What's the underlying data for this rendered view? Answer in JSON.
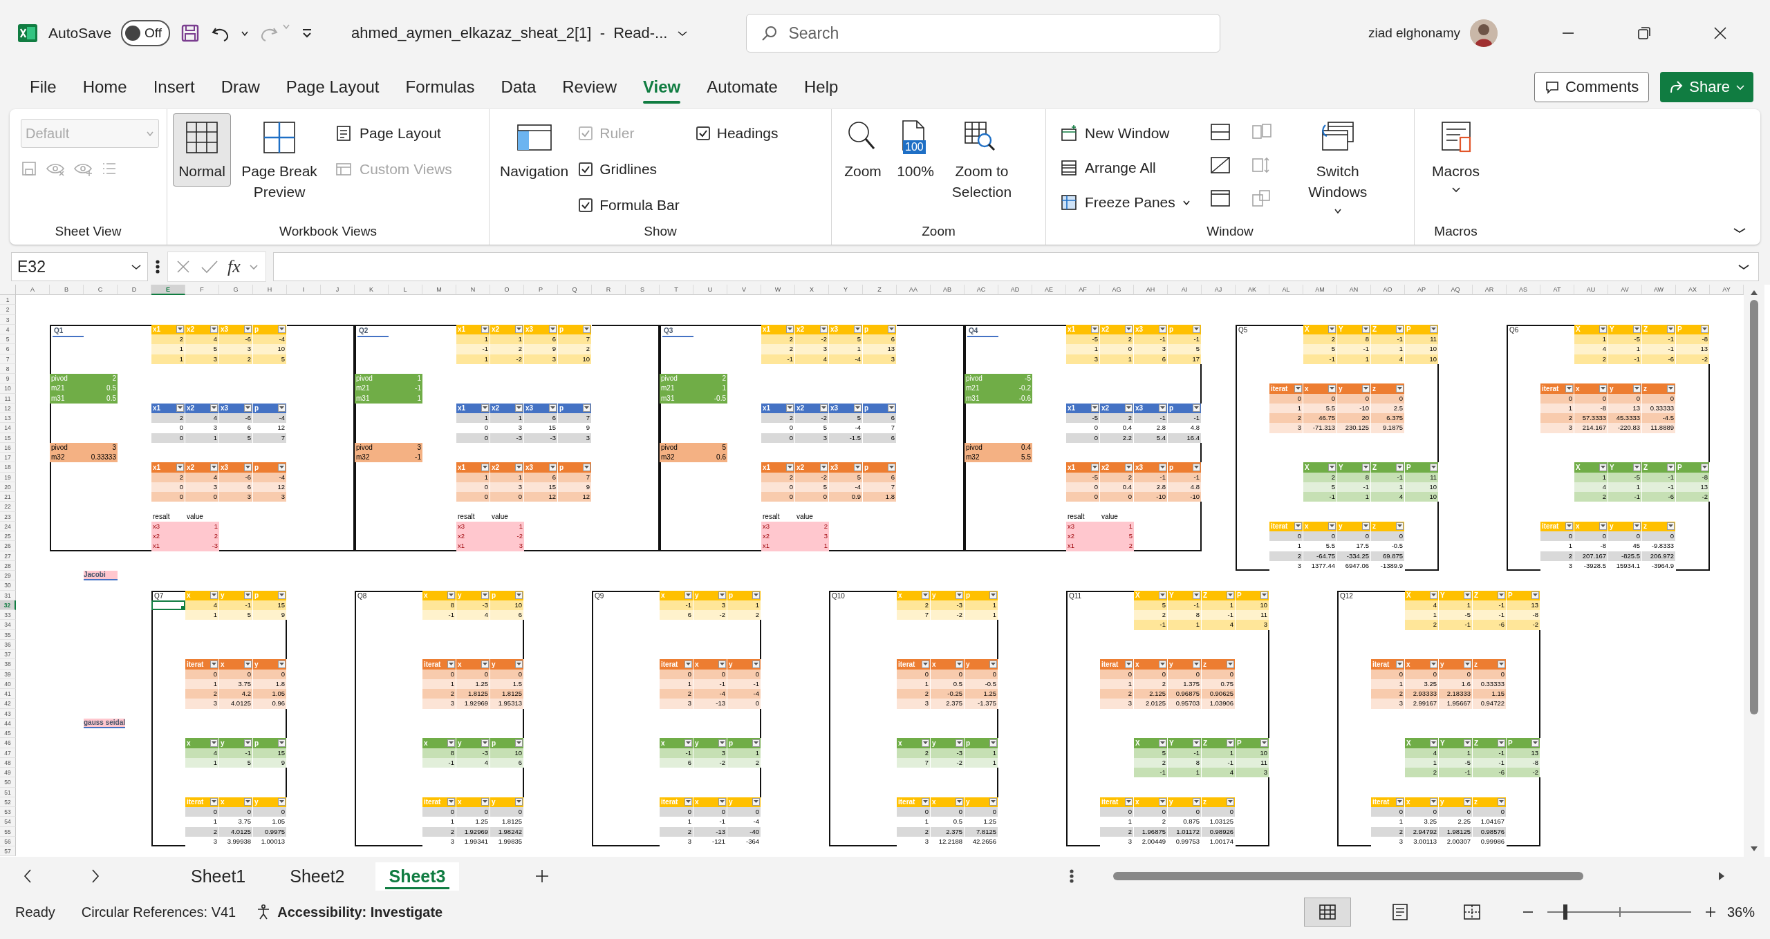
{
  "title_bar": {
    "autosave_label": "AutoSave",
    "autosave": {
      "on": false,
      "label": "Off"
    },
    "filename": "ahmed_aymen_elkazaz_sheat_2[1]  -  Read-...",
    "search_placeholder": "Search",
    "user": "ziad elghonamy"
  },
  "menu": {
    "tabs": [
      {
        "label": "File",
        "selected": false
      },
      {
        "label": "Home",
        "selected": false
      },
      {
        "label": "Insert",
        "selected": false
      },
      {
        "label": "Draw",
        "selected": false
      },
      {
        "label": "Page Layout",
        "selected": false
      },
      {
        "label": "Formulas",
        "selected": false
      },
      {
        "label": "Data",
        "selected": false
      },
      {
        "label": "Review",
        "selected": false
      },
      {
        "label": "View",
        "selected": true
      },
      {
        "label": "Automate",
        "selected": false
      },
      {
        "label": "Help",
        "selected": false
      }
    ],
    "comments": "Comments",
    "share": "Share"
  },
  "ribbon": {
    "sheet_view": {
      "label": "Sheet View",
      "dropdown": {
        "value": "Default",
        "disabled": true
      }
    },
    "workbook_views": {
      "label": "Workbook Views",
      "buttons": [
        {
          "label": "Normal",
          "selected": true
        },
        {
          "label": "Page Break Preview",
          "selected": false
        }
      ],
      "small_buttons": [
        {
          "label": "Page Layout",
          "disabled": false
        },
        {
          "label": "Custom Views",
          "disabled": true
        }
      ]
    },
    "show": {
      "label": "Show",
      "navigation": "Navigation",
      "checkboxes": [
        {
          "label": "Ruler",
          "checked": true,
          "disabled": true
        },
        {
          "label": "Gridlines",
          "checked": true,
          "disabled": false
        },
        {
          "label": "Formula Bar",
          "checked": true,
          "disabled": false
        },
        {
          "label": "Headings",
          "checked": true,
          "disabled": false
        }
      ]
    },
    "zoom": {
      "label": "Zoom",
      "buttons": [
        {
          "label": "Zoom"
        },
        {
          "label": "100%",
          "badge": "100"
        },
        {
          "label": "Zoom to Selection"
        }
      ]
    },
    "window": {
      "label": "Window",
      "buttons": [
        {
          "label": "New Window"
        },
        {
          "label": "Arrange All"
        },
        {
          "label": "Freeze Panes"
        }
      ],
      "switch": "Switch Windows"
    },
    "macros": {
      "label": "Macros",
      "button": "Macros"
    }
  },
  "formula_bar": {
    "name_box": "E32",
    "function_label": "fx"
  },
  "sheet": {
    "columns": [
      {
        "label": "A",
        "selected": false
      },
      {
        "label": "B",
        "selected": false
      },
      {
        "label": "C",
        "selected": false
      },
      {
        "label": "D",
        "selected": false
      },
      {
        "label": "E",
        "selected": true
      },
      {
        "label": "F",
        "selected": false
      },
      {
        "label": "G",
        "selected": false
      },
      {
        "label": "H",
        "selected": false
      },
      {
        "label": "I",
        "selected": false
      },
      {
        "label": "J",
        "selected": false
      },
      {
        "label": "K",
        "selected": false
      },
      {
        "label": "L",
        "selected": false
      },
      {
        "label": "M",
        "selected": false
      },
      {
        "label": "N",
        "selected": false
      },
      {
        "label": "O",
        "selected": false
      },
      {
        "label": "P",
        "selected": false
      },
      {
        "label": "Q",
        "selected": false
      },
      {
        "label": "R",
        "selected": false
      },
      {
        "label": "S",
        "selected": false
      },
      {
        "label": "T",
        "selected": false
      },
      {
        "label": "U",
        "selected": false
      },
      {
        "label": "V",
        "selected": false
      },
      {
        "label": "W",
        "selected": false
      },
      {
        "label": "X",
        "selected": false
      },
      {
        "label": "Y",
        "selected": false
      },
      {
        "label": "Z",
        "selected": false
      },
      {
        "label": "AA",
        "selected": false
      },
      {
        "label": "AB",
        "selected": false
      },
      {
        "label": "AC",
        "selected": false
      },
      {
        "label": "AD",
        "selected": false
      },
      {
        "label": "AE",
        "selected": false
      },
      {
        "label": "AF",
        "selected": false
      },
      {
        "label": "AG",
        "selected": false
      },
      {
        "label": "AH",
        "selected": false
      },
      {
        "label": "AI",
        "selected": false
      },
      {
        "label": "AJ",
        "selected": false
      },
      {
        "label": "AK",
        "selected": false
      },
      {
        "label": "AL",
        "selected": false
      },
      {
        "label": "AM",
        "selected": false
      },
      {
        "label": "AN",
        "selected": false
      },
      {
        "label": "AO",
        "selected": false
      },
      {
        "label": "AP",
        "selected": false
      },
      {
        "label": "AQ",
        "selected": false
      },
      {
        "label": "AR",
        "selected": false
      },
      {
        "label": "AS",
        "selected": false
      },
      {
        "label": "AT",
        "selected": false
      },
      {
        "label": "AU",
        "selected": false
      },
      {
        "label": "AV",
        "selected": false
      },
      {
        "label": "AW",
        "selected": false
      },
      {
        "label": "AX",
        "selected": false
      },
      {
        "label": "AY",
        "selected": false
      }
    ],
    "rows": [
      {
        "label": "1",
        "selected": false
      },
      {
        "label": "2",
        "selected": false
      },
      {
        "label": "3",
        "selected": false
      },
      {
        "label": "4",
        "selected": false
      },
      {
        "label": "5",
        "selected": false
      },
      {
        "label": "6",
        "selected": false
      },
      {
        "label": "7",
        "selected": false
      },
      {
        "label": "8",
        "selected": false
      },
      {
        "label": "9",
        "selected": false
      },
      {
        "label": "10",
        "selected": false
      },
      {
        "label": "11",
        "selected": false
      },
      {
        "label": "12",
        "selected": false
      },
      {
        "label": "13",
        "selected": false
      },
      {
        "label": "14",
        "selected": false
      },
      {
        "label": "15",
        "selected": false
      },
      {
        "label": "16",
        "selected": false
      },
      {
        "label": "17",
        "selected": false
      },
      {
        "label": "18",
        "selected": false
      },
      {
        "label": "19",
        "selected": false
      },
      {
        "label": "20",
        "selected": false
      },
      {
        "label": "21",
        "selected": false
      },
      {
        "label": "22",
        "selected": false
      },
      {
        "label": "23",
        "selected": false
      },
      {
        "label": "24",
        "selected": false
      },
      {
        "label": "25",
        "selected": false
      },
      {
        "label": "26",
        "selected": false
      },
      {
        "label": "27",
        "selected": false
      },
      {
        "label": "28",
        "selected": false
      },
      {
        "label": "29",
        "selected": false
      },
      {
        "label": "30",
        "selected": false
      },
      {
        "label": "31",
        "selected": false
      },
      {
        "label": "32",
        "selected": true
      },
      {
        "label": "33",
        "selected": false
      },
      {
        "label": "34",
        "selected": false
      },
      {
        "label": "35",
        "selected": false
      },
      {
        "label": "36",
        "selected": false
      },
      {
        "label": "37",
        "selected": false
      },
      {
        "label": "38",
        "selected": false
      },
      {
        "label": "39",
        "selected": false
      },
      {
        "label": "40",
        "selected": false
      },
      {
        "label": "41",
        "selected": false
      },
      {
        "label": "42",
        "selected": false
      },
      {
        "label": "43",
        "selected": false
      },
      {
        "label": "44",
        "selected": false
      },
      {
        "label": "45",
        "selected": false
      },
      {
        "label": "46",
        "selected": false
      },
      {
        "label": "47",
        "selected": false
      },
      {
        "label": "48",
        "selected": false
      },
      {
        "label": "49",
        "selected": false
      },
      {
        "label": "50",
        "selected": false
      },
      {
        "label": "51",
        "selected": false
      },
      {
        "label": "52",
        "selected": false
      },
      {
        "label": "53",
        "selected": false
      },
      {
        "label": "54",
        "selected": false
      },
      {
        "label": "55",
        "selected": false
      },
      {
        "label": "56",
        "selected": false
      },
      {
        "label": "57",
        "selected": false
      }
    ],
    "notes": [
      {
        "text": "Jacobi"
      },
      {
        "text": "gauss seidal"
      }
    ],
    "sections": [
      {
        "label": "Q1",
        "kind": "elimination",
        "tables": [
          {
            "columns": [
              "x1",
              "x2",
              "x3",
              "p"
            ],
            "rows": [
              [
                "2",
                "4",
                "-6",
                "-4"
              ],
              [
                "1",
                "5",
                "3",
                "10"
              ],
              [
                "1",
                "3",
                "2",
                "5"
              ]
            ]
          },
          {
            "columns": [
              "x1",
              "x2",
              "x3",
              "p"
            ],
            "rows": [
              [
                "2",
                "4",
                "-6",
                "-4"
              ],
              [
                "0",
                "3",
                "6",
                "12"
              ],
              [
                "0",
                "1",
                "5",
                "7"
              ]
            ]
          },
          {
            "columns": [
              "x1",
              "x2",
              "x3",
              "p"
            ],
            "rows": [
              [
                "2",
                "4",
                "-6",
                "-4"
              ],
              [
                "0",
                "3",
                "6",
                "12"
              ],
              [
                "0",
                "0",
                "3",
                "3"
              ]
            ]
          }
        ],
        "pivots": [
          {
            "rows": [
              [
                "pivod",
                "2"
              ],
              [
                "m21",
                "0.5"
              ],
              [
                "m31",
                "0.5"
              ]
            ]
          },
          {
            "rows": [
              [
                "pivod",
                "3"
              ],
              [
                "m32",
                "0.33333"
              ]
            ]
          }
        ],
        "result": {
          "columns": [
            "resalt",
            "value"
          ],
          "rows": [
            [
              "x3",
              "1"
            ],
            [
              "x2",
              "2"
            ],
            [
              "x1",
              "-3"
            ]
          ]
        }
      },
      {
        "label": "Q2",
        "kind": "elimination",
        "tables": [
          {
            "columns": [
              "x1",
              "x2",
              "x3",
              "p"
            ],
            "rows": [
              [
                "1",
                "1",
                "6",
                "7"
              ],
              [
                "-1",
                "2",
                "9",
                "2"
              ],
              [
                "1",
                "-2",
                "3",
                "10"
              ]
            ]
          },
          {
            "columns": [
              "x1",
              "x2",
              "x3",
              "p"
            ],
            "rows": [
              [
                "1",
                "1",
                "6",
                "7"
              ],
              [
                "0",
                "3",
                "15",
                "9"
              ],
              [
                "0",
                "-3",
                "-3",
                "3"
              ]
            ]
          },
          {
            "columns": [
              "x1",
              "x2",
              "x3",
              "p"
            ],
            "rows": [
              [
                "1",
                "1",
                "6",
                "7"
              ],
              [
                "0",
                "3",
                "15",
                "9"
              ],
              [
                "0",
                "0",
                "12",
                "12"
              ]
            ]
          }
        ],
        "pivots": [
          {
            "rows": [
              [
                "pivod",
                "1"
              ],
              [
                "m21",
                "-1"
              ],
              [
                "m31",
                "1"
              ]
            ]
          },
          {
            "rows": [
              [
                "pivod",
                "3"
              ],
              [
                "m32",
                "-1"
              ]
            ]
          }
        ],
        "result": {
          "columns": [
            "resalt",
            "value"
          ],
          "rows": [
            [
              "x3",
              "1"
            ],
            [
              "x2",
              "-2"
            ],
            [
              "x1",
              "3"
            ]
          ]
        }
      },
      {
        "label": "Q3",
        "kind": "elimination",
        "tables": [
          {
            "columns": [
              "x1",
              "x2",
              "x3",
              "p"
            ],
            "rows": [
              [
                "2",
                "-2",
                "5",
                "6"
              ],
              [
                "2",
                "3",
                "1",
                "13"
              ],
              [
                "-1",
                "4",
                "-4",
                "3"
              ]
            ]
          },
          {
            "columns": [
              "x1",
              "x2",
              "x3",
              "p"
            ],
            "rows": [
              [
                "2",
                "-2",
                "5",
                "6"
              ],
              [
                "0",
                "5",
                "-4",
                "7"
              ],
              [
                "0",
                "3",
                "-1.5",
                "6"
              ]
            ]
          },
          {
            "columns": [
              "x1",
              "x2",
              "x3",
              "p"
            ],
            "rows": [
              [
                "2",
                "-2",
                "5",
                "6"
              ],
              [
                "0",
                "5",
                "-4",
                "7"
              ],
              [
                "0",
                "0",
                "0.9",
                "1.8"
              ]
            ]
          }
        ],
        "pivots": [
          {
            "rows": [
              [
                "pivod",
                "2"
              ],
              [
                "m21",
                "1"
              ],
              [
                "m31",
                "-0.5"
              ]
            ]
          },
          {
            "rows": [
              [
                "pivod",
                "5"
              ],
              [
                "m32",
                "0.6"
              ]
            ]
          }
        ],
        "result": {
          "columns": [
            "resalt",
            "value"
          ],
          "rows": [
            [
              "x3",
              "2"
            ],
            [
              "x2",
              "3"
            ],
            [
              "x1",
              "1"
            ]
          ]
        }
      },
      {
        "label": "Q4",
        "kind": "elimination",
        "tables": [
          {
            "columns": [
              "x1",
              "x2",
              "x3",
              "p"
            ],
            "rows": [
              [
                "-5",
                "2",
                "-1",
                "-1"
              ],
              [
                "1",
                "0",
                "3",
                "5"
              ],
              [
                "3",
                "1",
                "6",
                "17"
              ]
            ]
          },
          {
            "columns": [
              "x1",
              "x2",
              "x3",
              "p"
            ],
            "rows": [
              [
                "-5",
                "2",
                "-1",
                "-1"
              ],
              [
                "0",
                "0.4",
                "2.8",
                "4.8"
              ],
              [
                "0",
                "2.2",
                "5.4",
                "16.4"
              ]
            ]
          },
          {
            "columns": [
              "x1",
              "x2",
              "x3",
              "p"
            ],
            "rows": [
              [
                "-5",
                "2",
                "-1",
                "-1"
              ],
              [
                "0",
                "0.4",
                "2.8",
                "4.8"
              ],
              [
                "0",
                "0",
                "-10",
                "-10"
              ]
            ]
          }
        ],
        "pivots": [
          {
            "rows": [
              [
                "pivod",
                "-5"
              ],
              [
                "m21",
                "-0.2"
              ],
              [
                "m31",
                "-0.6"
              ]
            ]
          },
          {
            "rows": [
              [
                "pivod",
                "0.4"
              ],
              [
                "m32",
                "5.5"
              ]
            ]
          }
        ],
        "result": {
          "columns": [
            "resalt",
            "value"
          ],
          "rows": [
            [
              "x3",
              "1"
            ],
            [
              "x2",
              "5"
            ],
            [
              "x1",
              "2"
            ]
          ]
        }
      },
      {
        "label": "Q5",
        "kind": "iteration",
        "tables": [
          {
            "columns": [
              "X",
              "Y",
              "Z",
              "P"
            ],
            "rows": [
              [
                "2",
                "8",
                "-1",
                "11"
              ],
              [
                "5",
                "-1",
                "1",
                "10"
              ],
              [
                "-1",
                "1",
                "4",
                "10"
              ]
            ]
          },
          {
            "columns": [
              "iterat",
              "x",
              "y",
              "z"
            ],
            "rows": [
              [
                "0",
                "0",
                "0",
                "0"
              ],
              [
                "1",
                "5.5",
                "-10",
                "2.5"
              ],
              [
                "2",
                "46.75",
                "20",
                "6.375"
              ],
              [
                "3",
                "-71.313",
                "230.125",
                "9.1875"
              ]
            ]
          },
          {
            "columns": [
              "X",
              "Y",
              "Z",
              "P"
            ],
            "rows": [
              [
                "2",
                "8",
                "-1",
                "11"
              ],
              [
                "5",
                "-1",
                "1",
                "10"
              ],
              [
                "-1",
                "1",
                "4",
                "10"
              ]
            ]
          },
          {
            "columns": [
              "iterat",
              "x",
              "y",
              "z"
            ],
            "rows": [
              [
                "0",
                "0",
                "0",
                "0"
              ],
              [
                "1",
                "5.5",
                "17.5",
                "-0.5"
              ],
              [
                "2",
                "-64.75",
                "-334.25",
                "69.875"
              ],
              [
                "3",
                "1377.44",
                "6947.06",
                "-1389.9"
              ]
            ]
          }
        ]
      },
      {
        "label": "Q6",
        "kind": "iteration",
        "tables": [
          {
            "columns": [
              "X",
              "Y",
              "Z",
              "P"
            ],
            "rows": [
              [
                "1",
                "-5",
                "-1",
                "-8"
              ],
              [
                "4",
                "1",
                "-1",
                "13"
              ],
              [
                "2",
                "-1",
                "-6",
                "-2"
              ]
            ]
          },
          {
            "columns": [
              "iterat",
              "x",
              "y",
              "z"
            ],
            "rows": [
              [
                "0",
                "0",
                "0",
                "0"
              ],
              [
                "1",
                "-8",
                "13",
                "0.33333"
              ],
              [
                "2",
                "57.3333",
                "45.3333",
                "-4.5"
              ],
              [
                "3",
                "214.167",
                "-220.83",
                "11.8889"
              ]
            ]
          },
          {
            "columns": [
              "X",
              "Y",
              "Z",
              "P"
            ],
            "rows": [
              [
                "1",
                "-5",
                "-1",
                "-8"
              ],
              [
                "4",
                "1",
                "-1",
                "13"
              ],
              [
                "2",
                "-1",
                "-6",
                "-2"
              ]
            ]
          },
          {
            "columns": [
              "iterat",
              "x",
              "y",
              "z"
            ],
            "rows": [
              [
                "0",
                "0",
                "0",
                "0"
              ],
              [
                "1",
                "-8",
                "45",
                "-9.8333"
              ],
              [
                "2",
                "207.167",
                "-825.5",
                "206.972"
              ],
              [
                "3",
                "-3928.5",
                "15934.1",
                "-3964.9"
              ]
            ]
          }
        ]
      },
      {
        "label": "Q7",
        "kind": "iteration",
        "tables": [
          {
            "columns": [
              "x",
              "y",
              "p"
            ],
            "rows": [
              [
                "4",
                "-1",
                "15"
              ],
              [
                "1",
                "5",
                "9"
              ]
            ]
          },
          {
            "columns": [
              "iterat",
              "x",
              "y"
            ],
            "rows": [
              [
                "0",
                "0",
                "0"
              ],
              [
                "1",
                "3.75",
                "1.8"
              ],
              [
                "2",
                "4.2",
                "1.05"
              ],
              [
                "3",
                "4.0125",
                "0.96"
              ]
            ]
          },
          {
            "columns": [
              "x",
              "y",
              "p"
            ],
            "rows": [
              [
                "4",
                "-1",
                "15"
              ],
              [
                "1",
                "5",
                "9"
              ]
            ]
          },
          {
            "columns": [
              "iterat",
              "x",
              "y"
            ],
            "rows": [
              [
                "0",
                "0",
                "0"
              ],
              [
                "1",
                "3.75",
                "1.05"
              ],
              [
                "2",
                "4.0125",
                "0.9975"
              ],
              [
                "3",
                "3.99938",
                "1.00013"
              ]
            ]
          }
        ]
      },
      {
        "label": "Q8",
        "kind": "iteration",
        "tables": [
          {
            "columns": [
              "x",
              "y",
              "p"
            ],
            "rows": [
              [
                "8",
                "-3",
                "10"
              ],
              [
                "-1",
                "4",
                "6"
              ]
            ]
          },
          {
            "columns": [
              "iterat",
              "x",
              "y"
            ],
            "rows": [
              [
                "0",
                "0",
                "0"
              ],
              [
                "1",
                "1.25",
                "1.5"
              ],
              [
                "2",
                "1.8125",
                "1.8125"
              ],
              [
                "3",
                "1.92969",
                "1.95313"
              ]
            ]
          },
          {
            "columns": [
              "x",
              "y",
              "p"
            ],
            "rows": [
              [
                "8",
                "-3",
                "10"
              ],
              [
                "-1",
                "4",
                "6"
              ]
            ]
          },
          {
            "columns": [
              "iterat",
              "x",
              "y"
            ],
            "rows": [
              [
                "0",
                "0",
                "0"
              ],
              [
                "1",
                "1.25",
                "1.8125"
              ],
              [
                "2",
                "1.92969",
                "1.98242"
              ],
              [
                "3",
                "1.99341",
                "1.99835"
              ]
            ]
          }
        ]
      },
      {
        "label": "Q9",
        "kind": "iteration",
        "tables": [
          {
            "columns": [
              "x",
              "y",
              "p"
            ],
            "rows": [
              [
                "-1",
                "3",
                "1"
              ],
              [
                "6",
                "-2",
                "2"
              ]
            ]
          },
          {
            "columns": [
              "iterat",
              "x",
              "y"
            ],
            "rows": [
              [
                "0",
                "0",
                "0"
              ],
              [
                "1",
                "-1",
                "-1"
              ],
              [
                "2",
                "-4",
                "-4"
              ],
              [
                "3",
                "-13",
                "0"
              ]
            ]
          },
          {
            "columns": [
              "x",
              "y",
              "p"
            ],
            "rows": [
              [
                "-1",
                "3",
                "1"
              ],
              [
                "6",
                "-2",
                "2"
              ]
            ]
          },
          {
            "columns": [
              "iterat",
              "x",
              "y"
            ],
            "rows": [
              [
                "0",
                "0",
                "0"
              ],
              [
                "1",
                "-1",
                "-4"
              ],
              [
                "2",
                "-13",
                "-40"
              ],
              [
                "3",
                "-121",
                "-364"
              ]
            ]
          }
        ]
      },
      {
        "label": "Q10",
        "kind": "iteration",
        "tables": [
          {
            "columns": [
              "x",
              "y",
              "p"
            ],
            "rows": [
              [
                "2",
                "-3",
                "1"
              ],
              [
                "7",
                "-2",
                "1"
              ]
            ]
          },
          {
            "columns": [
              "iterat",
              "x",
              "y"
            ],
            "rows": [
              [
                "0",
                "0",
                "0"
              ],
              [
                "1",
                "0.5",
                "-0.5"
              ],
              [
                "2",
                "-0.25",
                "1.25"
              ],
              [
                "3",
                "2.375",
                "-1.375"
              ]
            ]
          },
          {
            "columns": [
              "x",
              "y",
              "p"
            ],
            "rows": [
              [
                "2",
                "-3",
                "1"
              ],
              [
                "7",
                "-2",
                "1"
              ]
            ]
          },
          {
            "columns": [
              "iterat",
              "x",
              "y"
            ],
            "rows": [
              [
                "0",
                "0",
                "0"
              ],
              [
                "1",
                "0.5",
                "1.25"
              ],
              [
                "2",
                "2.375",
                "7.8125"
              ],
              [
                "3",
                "12.2188",
                "42.2656"
              ]
            ]
          }
        ]
      },
      {
        "label": "Q11",
        "kind": "iteration",
        "tables": [
          {
            "columns": [
              "X",
              "Y",
              "Z",
              "P"
            ],
            "rows": [
              [
                "5",
                "-1",
                "1",
                "10"
              ],
              [
                "2",
                "8",
                "-1",
                "11"
              ],
              [
                "-1",
                "1",
                "4",
                "3"
              ]
            ]
          },
          {
            "columns": [
              "iterat",
              "x",
              "y",
              "z"
            ],
            "rows": [
              [
                "0",
                "0",
                "0",
                "0"
              ],
              [
                "1",
                "2",
                "1.375",
                "0.75"
              ],
              [
                "2",
                "2.125",
                "0.96875",
                "0.90625"
              ],
              [
                "3",
                "2.0125",
                "0.95703",
                "1.03906"
              ]
            ]
          },
          {
            "columns": [
              "X",
              "Y",
              "Z",
              "P"
            ],
            "rows": [
              [
                "5",
                "-1",
                "1",
                "10"
              ],
              [
                "2",
                "8",
                "-1",
                "11"
              ],
              [
                "-1",
                "1",
                "4",
                "3"
              ]
            ]
          },
          {
            "columns": [
              "iterat",
              "x",
              "y",
              "z"
            ],
            "rows": [
              [
                "0",
                "0",
                "0",
                "0"
              ],
              [
                "1",
                "2",
                "0.875",
                "1.03125"
              ],
              [
                "2",
                "1.96875",
                "1.01172",
                "0.98926"
              ],
              [
                "3",
                "2.00449",
                "0.99753",
                "1.00174"
              ]
            ]
          }
        ]
      },
      {
        "label": "Q12",
        "kind": "iteration",
        "tables": [
          {
            "columns": [
              "X",
              "Y",
              "Z",
              "P"
            ],
            "rows": [
              [
                "4",
                "1",
                "-1",
                "13"
              ],
              [
                "1",
                "-5",
                "-1",
                "-8"
              ],
              [
                "2",
                "-1",
                "-6",
                "-2"
              ]
            ]
          },
          {
            "columns": [
              "iterat",
              "x",
              "y",
              "z"
            ],
            "rows": [
              [
                "0",
                "0",
                "0",
                "0"
              ],
              [
                "1",
                "3.25",
                "1.6",
                "0.33333"
              ],
              [
                "2",
                "2.93333",
                "2.18333",
                "1.15"
              ],
              [
                "3",
                "2.99167",
                "1.95667",
                "0.94722"
              ]
            ]
          },
          {
            "columns": [
              "X",
              "Y",
              "Z",
              "P"
            ],
            "rows": [
              [
                "4",
                "1",
                "-1",
                "13"
              ],
              [
                "1",
                "-5",
                "-1",
                "-8"
              ],
              [
                "2",
                "-1",
                "-6",
                "-2"
              ]
            ]
          },
          {
            "columns": [
              "iterat",
              "x",
              "y",
              "z"
            ],
            "rows": [
              [
                "0",
                "0",
                "0",
                "0"
              ],
              [
                "1",
                "3.25",
                "2.25",
                "1.04167"
              ],
              [
                "2",
                "2.94792",
                "1.98125",
                "0.98576"
              ],
              [
                "3",
                "3.00113",
                "2.00307",
                "0.99986"
              ]
            ]
          }
        ]
      }
    ]
  },
  "sheet_tabs": [
    {
      "label": "Sheet1",
      "selected": false
    },
    {
      "label": "Sheet2",
      "selected": false
    },
    {
      "label": "Sheet3",
      "selected": true
    }
  ],
  "status_bar": {
    "mode": "Ready",
    "circular": "Circular References: V41",
    "accessibility": "Accessibility: Investigate",
    "views": [
      {
        "selected": true
      },
      {
        "selected": false
      },
      {
        "selected": false
      }
    ],
    "zoom": {
      "level": 0.12,
      "label": "36%"
    }
  }
}
